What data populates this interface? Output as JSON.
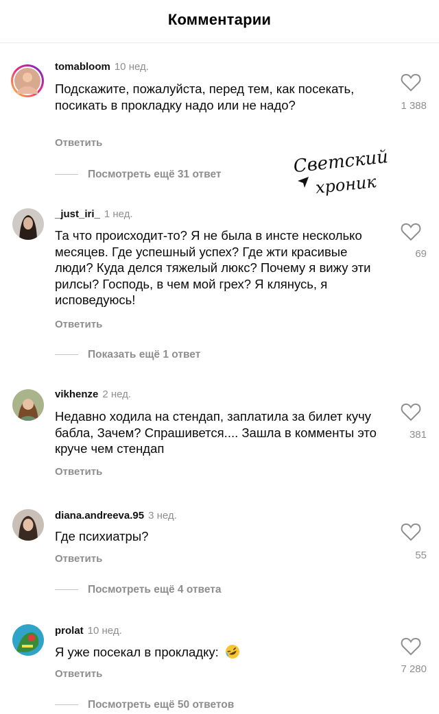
{
  "header": {
    "title": "Комментарии"
  },
  "watermark": {
    "line1": "Светский",
    "line2": "хроник"
  },
  "comments": [
    {
      "username": "tomabloom",
      "time": "10 нед.",
      "text": "Подскажите, пожалуйста, перед тем, как посекать, посикать в прокладку надо или не надо?",
      "likes": "1 388",
      "reply": "Ответить",
      "more": "Посмотреть ещё 31 ответ"
    },
    {
      "username": "_just_iri_",
      "time": "1 нед.",
      "text": "Та что происходит-то? Я не была в инсте несколько месяцев. Где успешный успех? Где жти красивые люди? Куда делся тяжелый люкс? Почему я вижу эти рилсы? Господь, в чем мой грех? Я клянусь, я исповедуюсь!",
      "likes": "69",
      "reply": "Ответить",
      "more": "Показать ещё 1 ответ"
    },
    {
      "username": "vikhenze",
      "time": "2 нед.",
      "text": "Недавно ходила на стендап, заплатила за билет кучу бабла, Зачем? Спрашивется.... Зашла в комменты это круче чем стендап",
      "likes": "381",
      "reply": "Ответить"
    },
    {
      "username": "diana.andreeva.95",
      "time": "3 нед.",
      "text": "Где психиатры?",
      "likes": "55",
      "reply": "Ответить",
      "more": "Посмотреть ещё 4 ответа"
    },
    {
      "username": "prolat",
      "time": "10 нед.",
      "text": "Я уже посекал в прокладку:",
      "emoji": "rolling-on-floor-laughing-emoji",
      "likes": "7 280",
      "reply": "Ответить",
      "more": "Посмотреть ещё 50 ответов"
    }
  ],
  "icons": {
    "like": "heart-outline-icon"
  },
  "colors": {
    "muted": "#8e8e8e",
    "story_ring": "#e1306c"
  }
}
